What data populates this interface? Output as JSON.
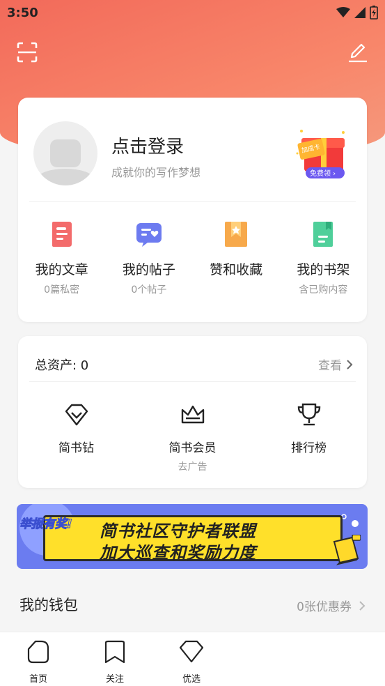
{
  "status": {
    "time": "3:50"
  },
  "profile": {
    "login_title": "点击登录",
    "login_sub": "成就你的写作梦想",
    "gift_card": "加成卡",
    "gift_btn": "免费领 ›"
  },
  "quick": [
    {
      "label": "我的文章",
      "sub": "0篇私密",
      "icon": "article-icon",
      "color": "#f36b6b"
    },
    {
      "label": "我的帖子",
      "sub": "0个帖子",
      "icon": "post-icon",
      "color": "#6d7bf0"
    },
    {
      "label": "赞和收藏",
      "sub": "",
      "icon": "star-bookmark-icon",
      "color": "#f7a94b"
    },
    {
      "label": "我的书架",
      "sub": "含已购内容",
      "icon": "bookshelf-icon",
      "color": "#4fcf9a"
    }
  ],
  "assets": {
    "title": "总资产: 0",
    "link": "查看",
    "items": [
      {
        "label": "简书钻",
        "sub": "",
        "icon": "diamond-icon"
      },
      {
        "label": "简书会员",
        "sub": "去广告",
        "icon": "crown-icon"
      },
      {
        "label": "排行榜",
        "sub": "",
        "icon": "trophy-icon"
      }
    ]
  },
  "banner": {
    "tag": "举报有奖!",
    "line1": "简书社区守护者联盟",
    "line2": "加大巡查和奖励力度"
  },
  "wallet": {
    "title": "我的钱包",
    "coupon": "0张优惠券"
  },
  "tabs": [
    {
      "label": "首页",
      "icon": "home-icon"
    },
    {
      "label": "关注",
      "icon": "follow-bookmark-icon"
    },
    {
      "label": "优选",
      "icon": "diamond-tab-icon"
    }
  ]
}
